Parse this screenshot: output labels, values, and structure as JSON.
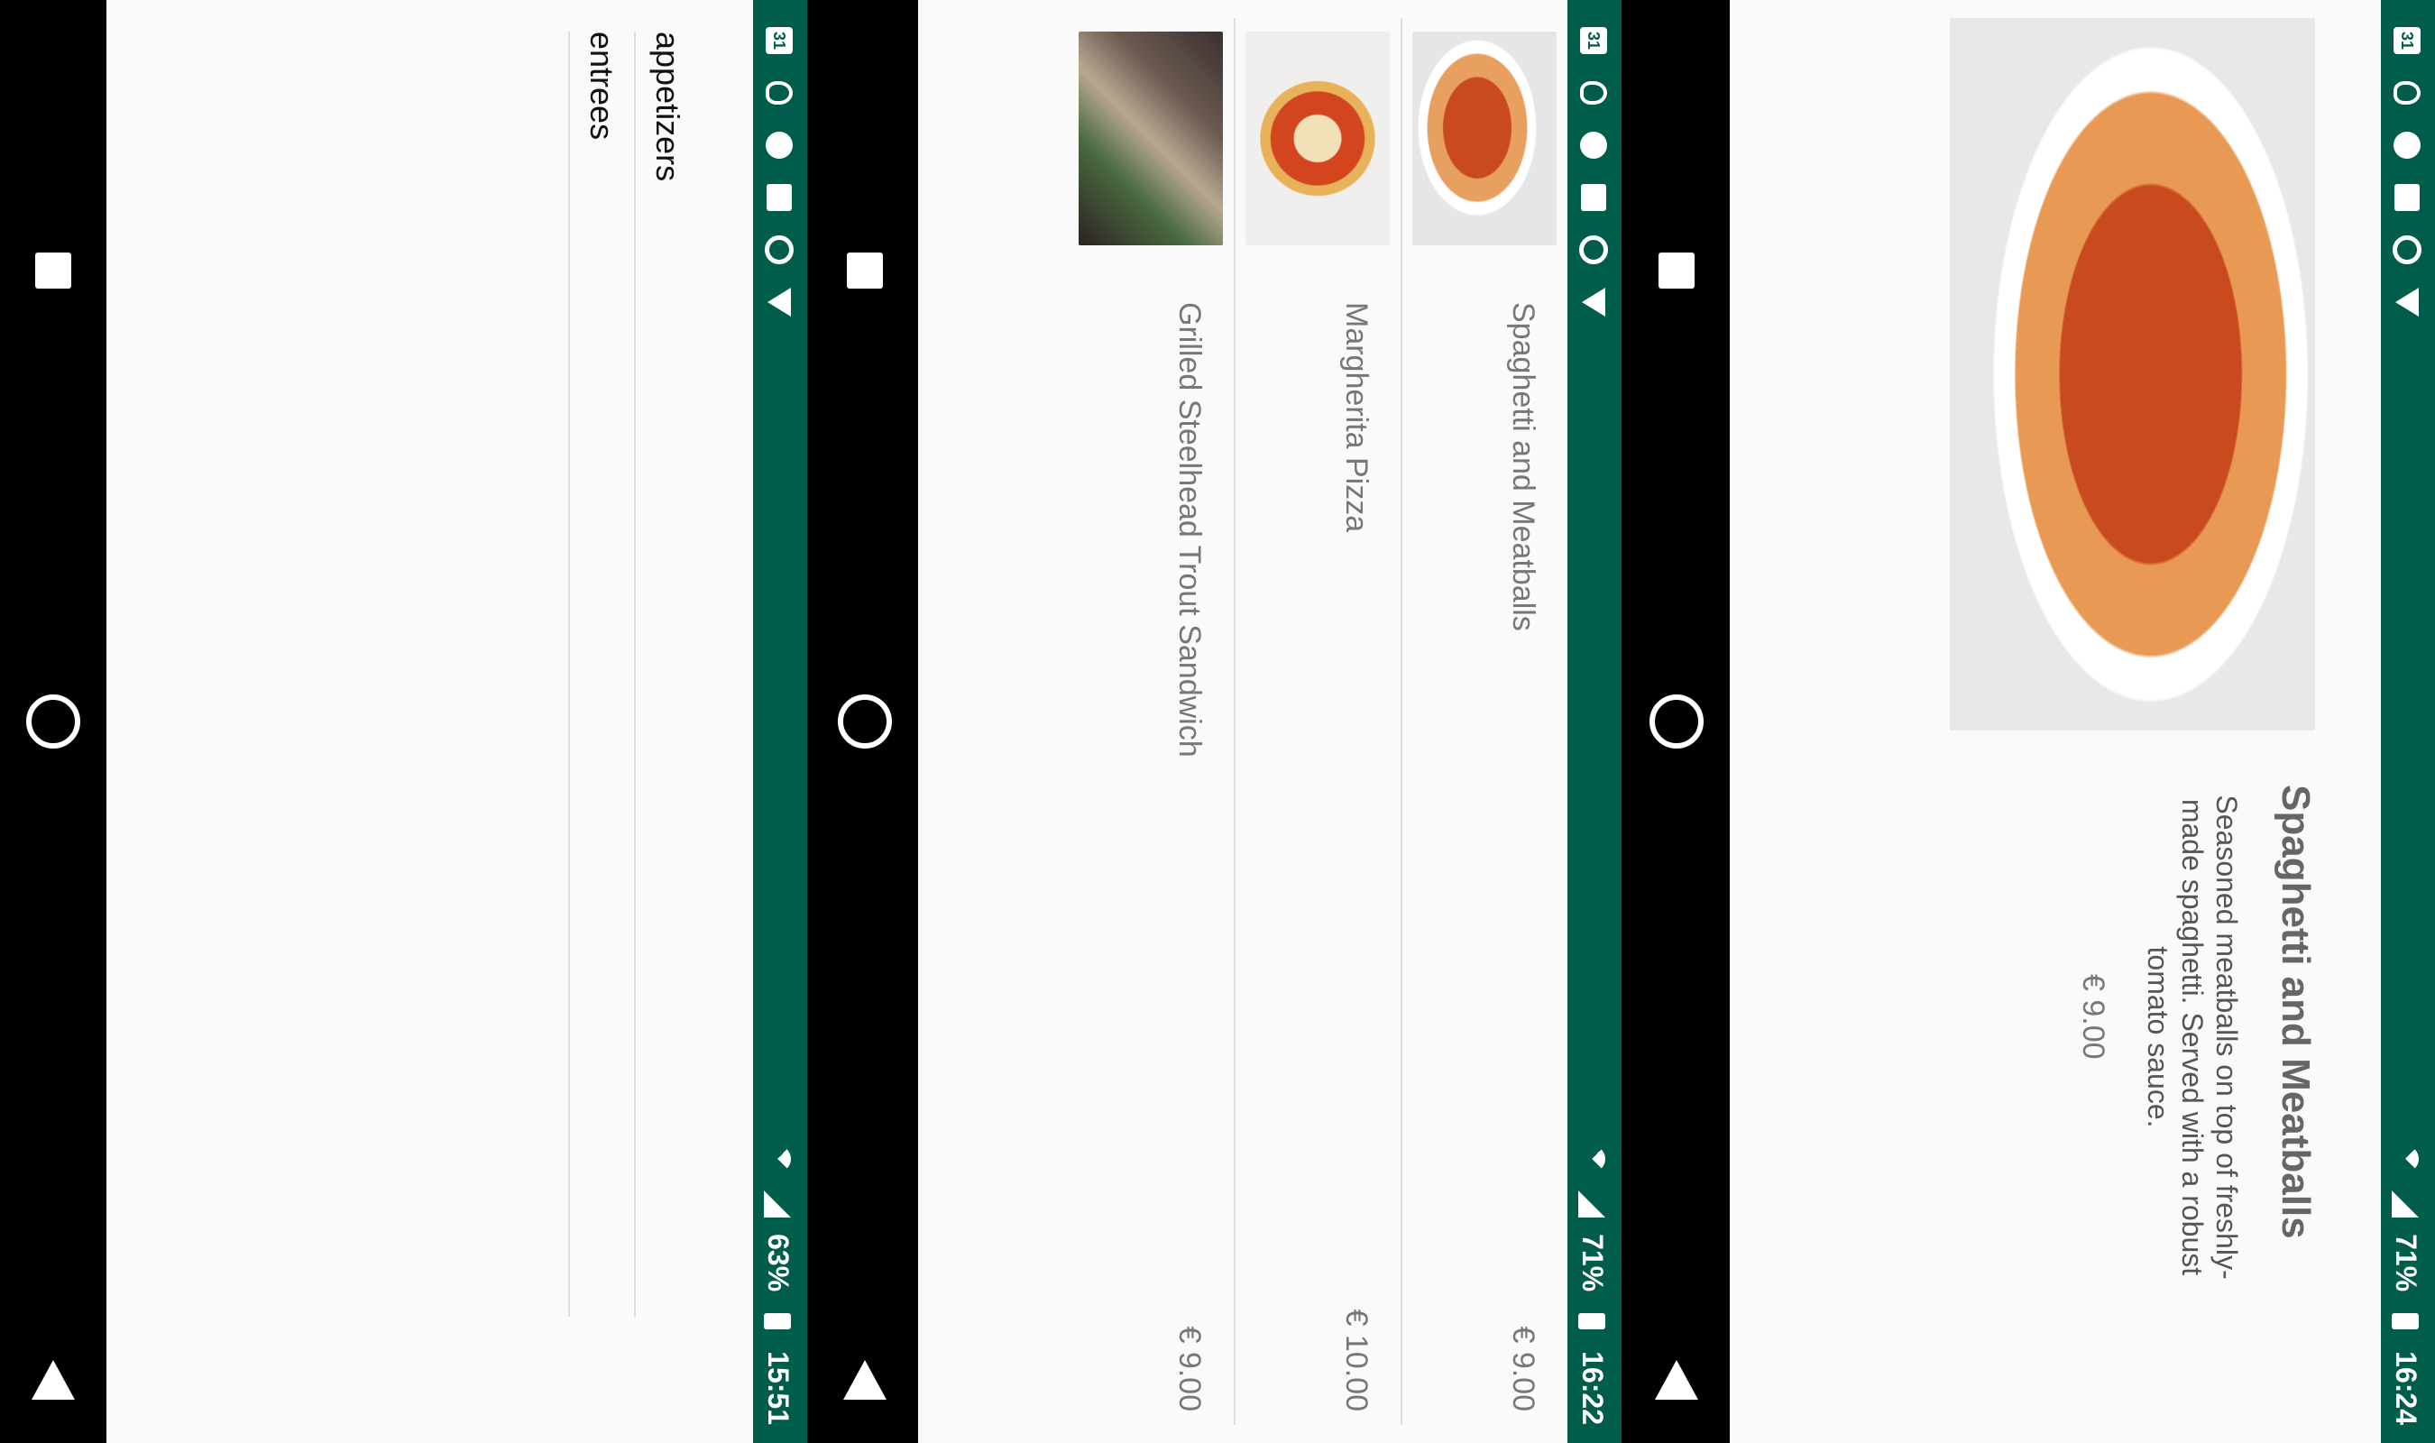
{
  "panels": {
    "categories": {
      "status": {
        "calendar_day": "31",
        "battery": "63%",
        "time": "15:51"
      },
      "items": [
        {
          "label": "appetizers"
        },
        {
          "label": "entrees"
        }
      ]
    },
    "menu": {
      "status": {
        "calendar_day": "31",
        "battery": "71%",
        "time": "16:22"
      },
      "items": [
        {
          "name": "Spaghetti and Meatballs",
          "price": "€ 9.00"
        },
        {
          "name": "Margherita Pizza",
          "price": "€ 10.00"
        },
        {
          "name": "Grilled Steelhead Trout Sandwich",
          "price": "€ 9.00"
        }
      ]
    },
    "detail": {
      "status": {
        "calendar_day": "31",
        "battery": "71%",
        "time": "16:24"
      },
      "title": "Spaghetti and Meatballs",
      "description": "Seasoned meatballs on top of freshly-made spaghetti. Served with a robust tomato sauce.",
      "price": "€ 9.00"
    }
  },
  "colors": {
    "status_bar": "#005c4b",
    "background": "#fafafa",
    "nav_bar": "#000000"
  },
  "icons": [
    "calendar-icon",
    "lightbulb-icon",
    "minus-circle-icon",
    "image-icon",
    "circle-icon",
    "arrow-icon",
    "wifi-icon",
    "signal-icon",
    "battery-icon",
    "back-icon",
    "home-icon",
    "recents-icon"
  ]
}
